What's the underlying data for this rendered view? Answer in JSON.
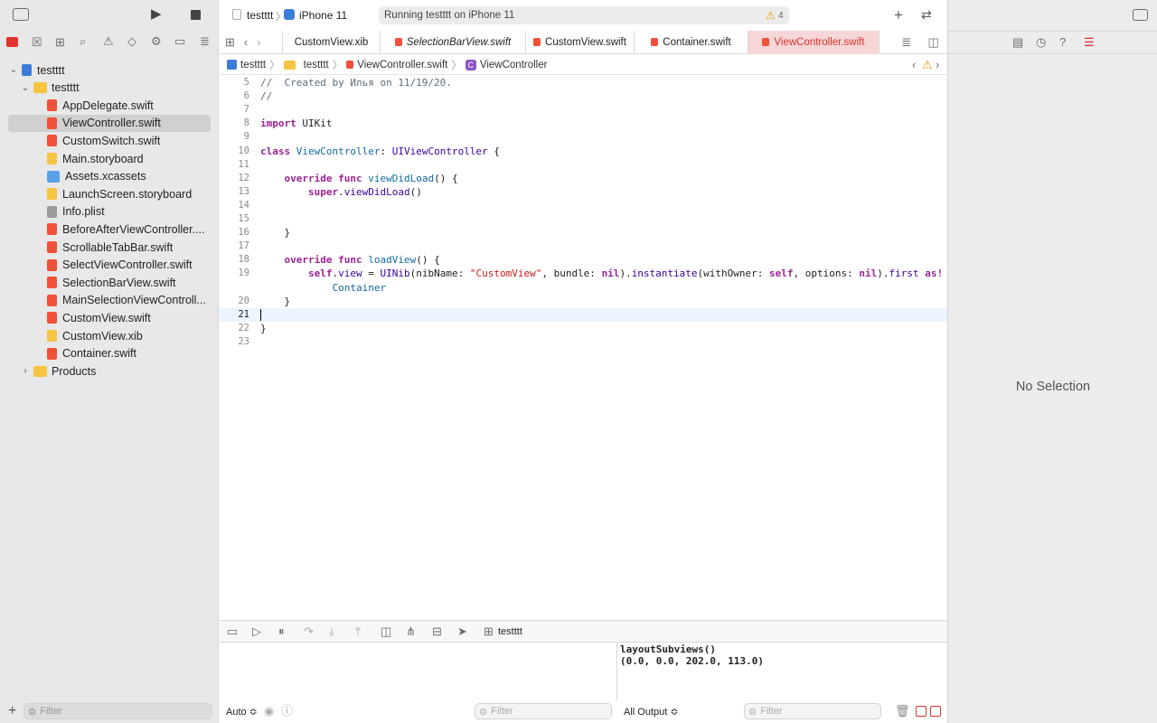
{
  "toolbar": {
    "scheme": "testttt",
    "device": "iPhone 11",
    "status": "Running testttt on iPhone 11",
    "warning_count": "4"
  },
  "navigator": {
    "root": "testttt",
    "group": "testttt",
    "files": [
      {
        "name": "AppDelegate.swift",
        "kind": "swift"
      },
      {
        "name": "ViewController.swift",
        "kind": "swift",
        "selected": true
      },
      {
        "name": "CustomSwitch.swift",
        "kind": "swift"
      },
      {
        "name": "Main.storyboard",
        "kind": "storyboard"
      },
      {
        "name": "Assets.xcassets",
        "kind": "assets"
      },
      {
        "name": "LaunchScreen.storyboard",
        "kind": "storyboard"
      },
      {
        "name": "Info.plist",
        "kind": "plist"
      },
      {
        "name": "BeforeAfterViewController....",
        "kind": "swift"
      },
      {
        "name": "ScrollableTabBar.swift",
        "kind": "swift"
      },
      {
        "name": "SelectViewController.swift",
        "kind": "swift"
      },
      {
        "name": "SelectionBarView.swift",
        "kind": "swift"
      },
      {
        "name": "MainSelectionViewControll...",
        "kind": "swift"
      },
      {
        "name": "CustomView.swift",
        "kind": "swift"
      },
      {
        "name": "CustomView.xib",
        "kind": "xib"
      },
      {
        "name": "Container.swift",
        "kind": "swift"
      }
    ],
    "products": "Products",
    "filter_placeholder": "Filter"
  },
  "tabs": [
    {
      "label": "CustomView.xib",
      "italic": false,
      "active": false
    },
    {
      "label": "SelectionBarView.swift",
      "italic": true,
      "active": false
    },
    {
      "label": "CustomView.swift",
      "italic": false,
      "active": false
    },
    {
      "label": "Container.swift",
      "italic": false,
      "active": false
    },
    {
      "label": "ViewController.swift",
      "italic": false,
      "active": true
    }
  ],
  "jumpbar": {
    "project": "testttt",
    "group": "testttt",
    "file": "ViewController.swift",
    "symbol": "ViewController"
  },
  "code_lines": [
    {
      "n": "5",
      "html": "<span class=\"cm\">//  Created by Илья on 11/19/20.</span>"
    },
    {
      "n": "6",
      "html": "<span class=\"cm\">//</span>"
    },
    {
      "n": "7",
      "html": ""
    },
    {
      "n": "8",
      "html": "<span class=\"kw\">import</span> UIKit"
    },
    {
      "n": "9",
      "html": ""
    },
    {
      "n": "10",
      "html": "<span class=\"kw\">class</span> <span class=\"fn\">ViewController</span>: <span class=\"ty\">UIViewController</span> {"
    },
    {
      "n": "11",
      "html": ""
    },
    {
      "n": "12",
      "html": "    <span class=\"kw\">override</span> <span class=\"kw\">func</span> <span class=\"fn\">viewDidLoad</span>() {"
    },
    {
      "n": "13",
      "html": "        <span class=\"kw\">super</span>.<span class=\"ty\">viewDidLoad</span>()"
    },
    {
      "n": "14",
      "html": ""
    },
    {
      "n": "15",
      "html": ""
    },
    {
      "n": "16",
      "html": "    }"
    },
    {
      "n": "17",
      "html": ""
    },
    {
      "n": "18",
      "html": "    <span class=\"kw\">override</span> <span class=\"kw\">func</span> <span class=\"fn\">loadView</span>() {"
    },
    {
      "n": "19",
      "html": "        <span class=\"kw\">self</span>.<span class=\"ty\">view</span> = <span class=\"ty\">UINib</span>(nibName: <span class=\"str\">\"CustomView\"</span>, bundle: <span class=\"kw\">nil</span>).<span class=\"ty\">instantiate</span>(withOwner: <span class=\"kw\">self</span>, options: <span class=\"kw\">nil</span>).<span class=\"ty\">first</span> <span class=\"kw\">as!</span>"
    },
    {
      "n": "",
      "html": "            <span class=\"fn\">Container</span>"
    },
    {
      "n": "20",
      "html": "    }"
    },
    {
      "n": "21",
      "html": ""
    },
    {
      "n": "22",
      "html": "}"
    },
    {
      "n": "23",
      "html": ""
    }
  ],
  "debug": {
    "target": "testttt",
    "console_lines": [
      "layoutSubviews()",
      "(0.0, 0.0, 202.0, 113.0)"
    ],
    "auto_label": "Auto ≎",
    "output_label": "All Output ≎",
    "filter_placeholder": "Filter"
  },
  "inspector": {
    "empty_text": "No Selection"
  },
  "colors": {
    "active_tab": "#d9332d",
    "swift_icon": "#f05138",
    "folder": "#f6c443",
    "keyword": "#9b2393",
    "string": "#c41a16"
  }
}
